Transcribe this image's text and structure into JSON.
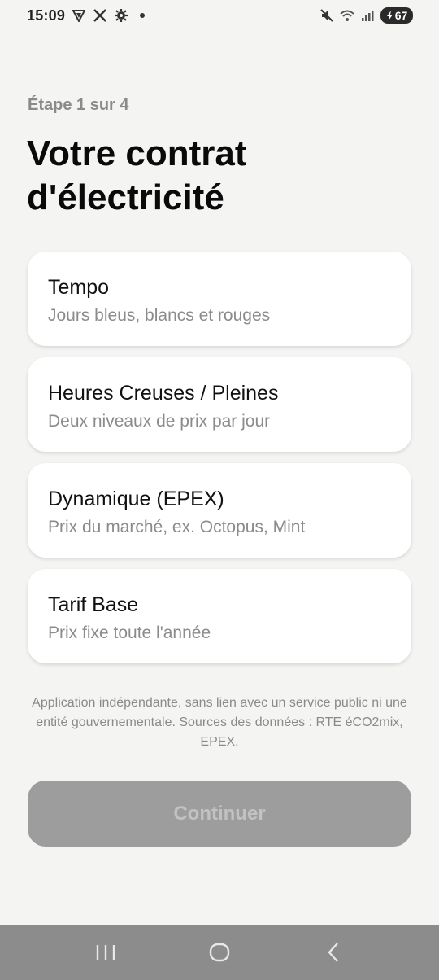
{
  "status_bar": {
    "time": "15:09",
    "battery": "67",
    "icons": [
      "vpn-icon",
      "x-icon",
      "gear-icon",
      "dot-icon",
      "mute-icon",
      "wifi-icon",
      "signal-icon",
      "battery-icon"
    ]
  },
  "step_label": "Étape 1 sur 4",
  "title_line1": "Votre contrat",
  "title_line2": "d'électricité",
  "options": [
    {
      "title": "Tempo",
      "subtitle": "Jours bleus, blancs et rouges"
    },
    {
      "title": "Heures Creuses / Pleines",
      "subtitle": "Deux niveaux de prix par jour"
    },
    {
      "title": "Dynamique (EPEX)",
      "subtitle": "Prix du marché, ex. Octopus, Mint"
    },
    {
      "title": "Tarif Base",
      "subtitle": "Prix fixe toute l'année"
    }
  ],
  "disclaimer": "Application indépendante, sans lien avec un service public ni une entité gouvernementale. Sources des données : RTE éCO2mix, EPEX.",
  "continue_label": "Continuer",
  "nav": [
    "recents-icon",
    "home-icon",
    "back-icon"
  ]
}
